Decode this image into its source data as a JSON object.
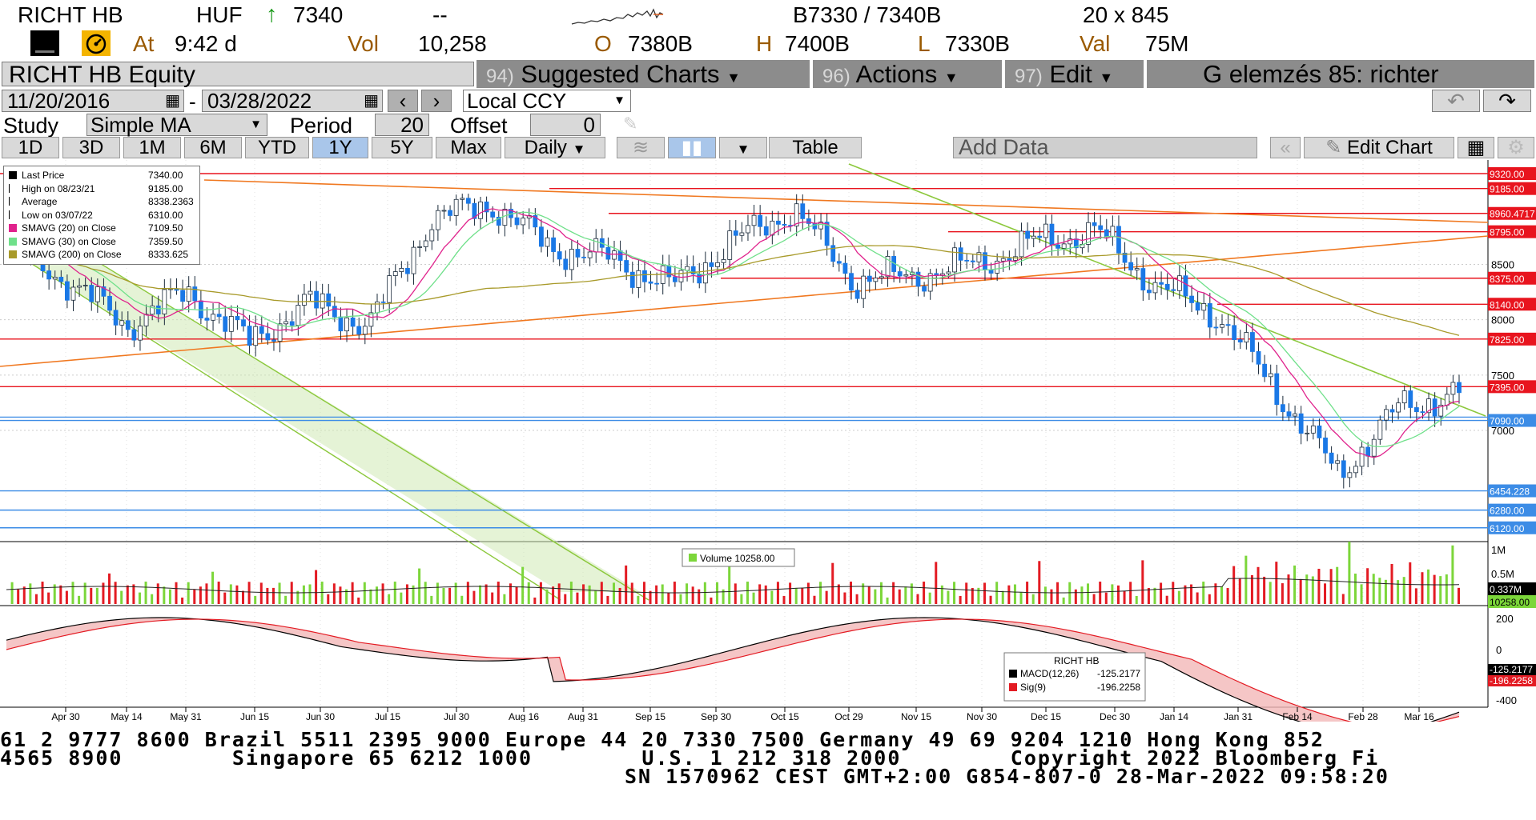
{
  "quote": {
    "ticker": "RICHT HB",
    "currency": "HUF",
    "last": "7340",
    "change": "--",
    "bid_ask": "B7330 / 7340B",
    "size": "20 x 845",
    "at_label": "At",
    "time": "9:42 d",
    "vol_label": "Vol",
    "vol": "10,258",
    "open_label": "O",
    "open": "7380B",
    "high_label": "H",
    "high": "7400B",
    "low_label": "L",
    "low": "7330B",
    "val_label": "Val",
    "val": "75M"
  },
  "toolbar": {
    "security": "RICHT HB Equity",
    "menu1_num": "94)",
    "menu1_label": "Suggested Charts",
    "menu2_num": "96)",
    "menu2_label": "Actions",
    "menu3_num": "97)",
    "menu3_label": "Edit",
    "page_title": "G elemzés 85: richter"
  },
  "dates": {
    "start": "11/20/2016",
    "sep": "-",
    "end": "03/28/2022",
    "ccy": "Local CCY"
  },
  "study": {
    "label": "Study",
    "value": "Simple MA",
    "period_label": "Period",
    "period": "20",
    "offset_label": "Offset",
    "offset": "0"
  },
  "ranges": [
    "1D",
    "3D",
    "1M",
    "6M",
    "YTD",
    "1Y",
    "5Y",
    "Max"
  ],
  "selected_range": "1Y",
  "frequency": "Daily",
  "buttons": {
    "table": "Table",
    "add_data": "Add Data",
    "edit_chart": "Edit Chart"
  },
  "legend": [
    {
      "label": "Last Price",
      "value": "7340.00",
      "color": "#000000",
      "type": "box"
    },
    {
      "label": "High on 08/23/21",
      "value": "9185.00",
      "color": "#000000",
      "type": "high"
    },
    {
      "label": "Average",
      "value": "8338.2363",
      "color": "#555555",
      "type": "avg"
    },
    {
      "label": "Low on 03/07/22",
      "value": "6310.00",
      "color": "#000000",
      "type": "low"
    },
    {
      "label": "SMAVG (20)  on Close",
      "value": "7109.50",
      "color": "#e0228c",
      "type": "box"
    },
    {
      "label": "SMAVG (30)  on Close",
      "value": "7359.50",
      "color": "#6fe08a",
      "type": "box"
    },
    {
      "label": "SMAVG (200)  on Close",
      "value": "8333.625",
      "color": "#a89a2a",
      "type": "box"
    }
  ],
  "volume_legend": "Volume  10258.00",
  "macd_legend": {
    "title": "RICHT HB",
    "macd_label": "MACD(12,26)",
    "macd_value": "-125.2177",
    "sig_label": "Sig(9)",
    "sig_value": "-196.2258"
  },
  "price_axis": {
    "ticks": [
      "8500",
      "8000",
      "7500",
      "7000"
    ],
    "red_labels": [
      "9320.00",
      "9185.00",
      "8960.4717",
      "8795.00",
      "8375.00",
      "8140.00",
      "7825.00",
      "7395.00"
    ],
    "blue_labels": [
      "7090.00",
      "6454.228",
      "6280.00",
      "6120.00"
    ]
  },
  "volume_axis": {
    "ticks": [
      "1M",
      "0.5M"
    ],
    "labels": [
      "0.337M",
      "10258.00"
    ]
  },
  "macd_axis": {
    "ticks": [
      "200",
      "0",
      "-400"
    ],
    "labels": [
      "-125.2177",
      "-196.2258"
    ]
  },
  "x_axis": {
    "dates": [
      "Apr 30",
      "May 14",
      "May 31",
      "Jun 15",
      "Jun 30",
      "Jul 15",
      "Jul 30",
      "Aug 16",
      "Aug 31",
      "Sep 15",
      "Sep 30",
      "Oct 15",
      "Oct 29",
      "Nov 15",
      "Nov 30",
      "Dec 15",
      "Dec 30",
      "Jan 14",
      "Jan 31",
      "Feb 14",
      "Feb 28",
      "Mar 16"
    ],
    "years": [
      "2021",
      "2022"
    ]
  },
  "footer": {
    "line1": "61 2 9777 8600 Brazil 5511 2395 9000 Europe 44 20 7330 7500 Germany 49 69 9204 1210 Hong Kong 852",
    "line2": "4565 8900        Singapore 65 6212 1000        U.S. 1 212 318 2000        Copyright 2022 Bloomberg Fi",
    "line3": "SN 1570962 CEST GMT+2:00 G854-807-0 28-Mar-2022 09:58:20"
  },
  "chart_data": {
    "type": "candlestick",
    "title": "RICHT HB Equity",
    "x_range": [
      "2021-04-20",
      "2022-03-28"
    ],
    "y_range": [
      6000,
      9400
    ],
    "dates": [
      "2021-04-30",
      "2021-05-14",
      "2021-05-31",
      "2021-06-15",
      "2021-06-30",
      "2021-07-15",
      "2021-07-30",
      "2021-08-16",
      "2021-08-23",
      "2021-08-31",
      "2021-09-15",
      "2021-09-30",
      "2021-10-15",
      "2021-10-29",
      "2021-11-15",
      "2021-11-30",
      "2021-12-15",
      "2021-12-30",
      "2022-01-14",
      "2022-01-31",
      "2022-02-14",
      "2022-02-28",
      "2022-03-07",
      "2022-03-16",
      "2022-03-28"
    ],
    "close": [
      8700,
      8350,
      7950,
      8250,
      7800,
      8150,
      7950,
      8900,
      9050,
      8650,
      8550,
      8300,
      8700,
      9000,
      8350,
      8400,
      8500,
      8700,
      8800,
      8300,
      8050,
      7350,
      6600,
      7200,
      7340
    ],
    "sma20_close": 7109.5,
    "sma30_close": 7359.5,
    "sma200_close": 8333.625,
    "high": {
      "date": "08/23/21",
      "value": 9185.0
    },
    "low": {
      "date": "03/07/22",
      "value": 6310.0
    },
    "average": 8338.2363,
    "last": 7340.0,
    "volume_last": 10258,
    "macd": -125.2177,
    "signal": -196.2258,
    "horizontal_red_levels": [
      9320.0,
      9185.0,
      8960.4717,
      8795.0,
      8375.0,
      8140.0,
      7825.0,
      7395.0
    ],
    "horizontal_blue_levels": [
      7090.0,
      6454.228,
      6280.0,
      6120.0
    ]
  },
  "colors": {
    "up": "#1a78e6",
    "down": "#1a78e6",
    "red_line": "#e8141e",
    "orange_line": "#f07820",
    "green_line": "#8cc83c",
    "blue_line": "#3c8ce6",
    "sma20": "#e0228c",
    "sma30": "#6fe08a",
    "sma200": "#a89a2a",
    "vol_up": "#7cd63a",
    "vol_down": "#e31b23"
  }
}
